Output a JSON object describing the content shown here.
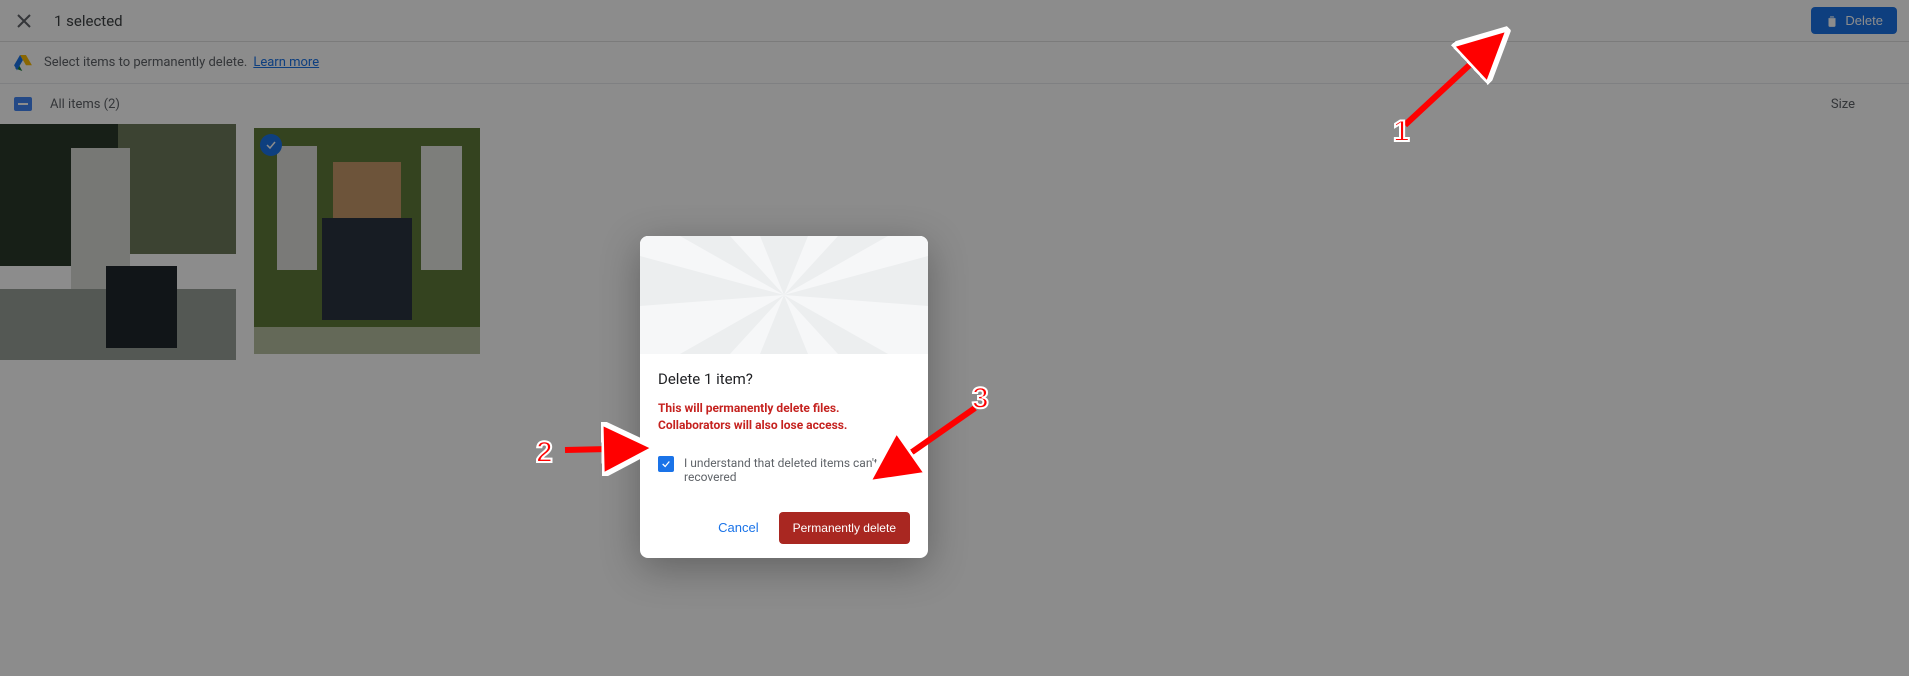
{
  "topbar": {
    "selected_text": "1 selected",
    "delete_label": "Delete"
  },
  "inforow": {
    "text": "Select items to permanently delete.",
    "learn_more": "Learn more"
  },
  "itemshdr": {
    "label": "All items (2)",
    "size_label": "Size"
  },
  "modal": {
    "title": "Delete 1 item?",
    "warning": "This will permanently delete files. Collaborators will also lose access.",
    "ack": "I understand that deleted items can't be recovered",
    "cancel": "Cancel",
    "permanent": "Permanently delete"
  },
  "annotations": {
    "n1": "1",
    "n2": "2",
    "n3": "3"
  }
}
